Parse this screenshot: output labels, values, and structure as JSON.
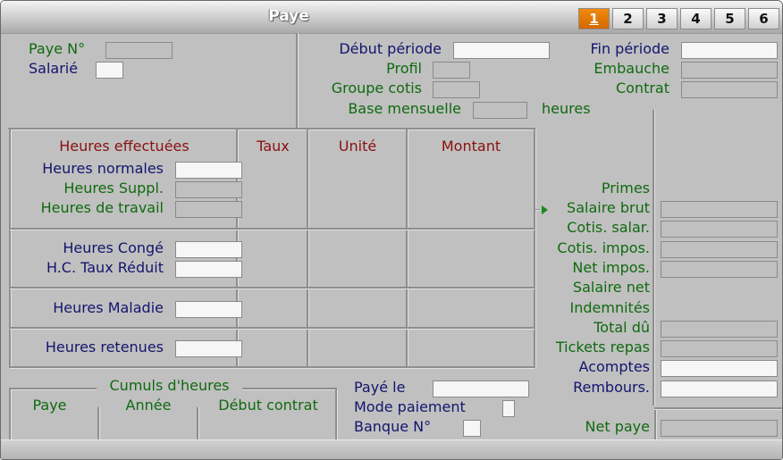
{
  "window": {
    "title": "Paye"
  },
  "tabs": [
    {
      "label": "1",
      "active": true
    },
    {
      "label": "2",
      "active": false
    },
    {
      "label": "3",
      "active": false
    },
    {
      "label": "4",
      "active": false
    },
    {
      "label": "5",
      "active": false
    },
    {
      "label": "6",
      "active": false
    }
  ],
  "header": {
    "paye_no": {
      "label": "Paye N°",
      "value": ""
    },
    "salarie": {
      "label": "Salarié",
      "value": ""
    },
    "debut_periode": {
      "label": "Début période",
      "value": ""
    },
    "fin_periode": {
      "label": "Fin période",
      "value": ""
    },
    "profil": {
      "label": "Profil",
      "value": ""
    },
    "embauche": {
      "label": "Embauche",
      "value": ""
    },
    "groupe_cotis": {
      "label": "Groupe cotis",
      "value": ""
    },
    "contrat": {
      "label": "Contrat",
      "value": ""
    },
    "base_mensuelle": {
      "label": "Base mensuelle",
      "value": "",
      "unit": "heures"
    }
  },
  "hours_table": {
    "columns": [
      "Heures effectuées",
      "Taux",
      "Unité",
      "Montant"
    ],
    "rows": [
      {
        "label": "Heures normales",
        "value": ""
      },
      {
        "label": "Heures Suppl.",
        "value": ""
      },
      {
        "label": "Heures de travail",
        "value": ""
      },
      {
        "label": "Heures Congé",
        "value": ""
      },
      {
        "label": "H.C. Taux Réduit",
        "value": ""
      },
      {
        "label": "Heures Maladie",
        "value": ""
      },
      {
        "label": "Heures retenues",
        "value": ""
      }
    ]
  },
  "totals": {
    "primes": {
      "label": "Primes"
    },
    "salaire_brut": {
      "label": "Salaire brut",
      "value": ""
    },
    "cotis_salar": {
      "label": "Cotis. salar.",
      "value": ""
    },
    "cotis_impos": {
      "label": "Cotis. impos.",
      "value": ""
    },
    "net_impos": {
      "label": "Net impos.",
      "value": ""
    },
    "salaire_net": {
      "label": "Salaire net"
    },
    "indemnites": {
      "label": "Indemnités"
    },
    "total_du": {
      "label": "Total dû",
      "value": ""
    },
    "tickets_repas": {
      "label": "Tickets repas",
      "value": ""
    },
    "acomptes": {
      "label": "Acomptes",
      "value": ""
    },
    "rembours": {
      "label": "Rembours.",
      "value": ""
    },
    "net_paye": {
      "label": "Net paye",
      "value": ""
    }
  },
  "cumuls": {
    "title": "Cumuls d'heures",
    "columns": [
      "Paye",
      "Année",
      "Début contrat"
    ]
  },
  "payment": {
    "paye_le": {
      "label": "Payé le",
      "value": ""
    },
    "mode_paiement": {
      "label": "Mode paiement",
      "value": ""
    },
    "banque_no": {
      "label": "Banque N°",
      "value": ""
    }
  }
}
